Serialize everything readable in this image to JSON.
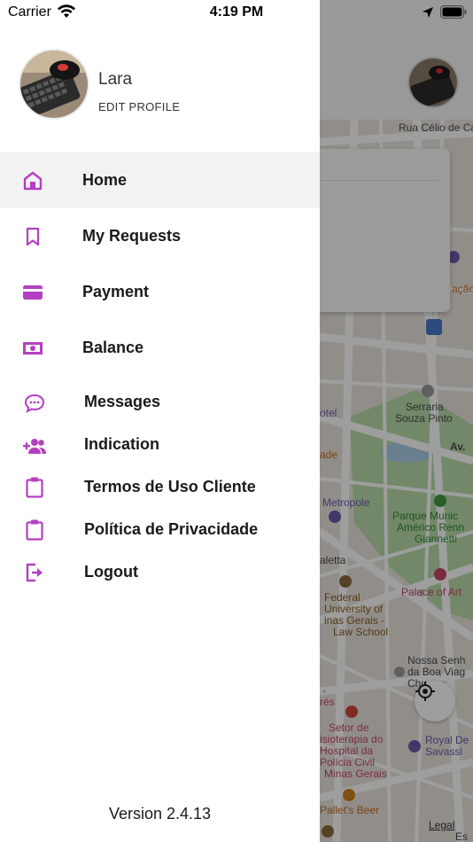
{
  "status_bar": {
    "carrier": "Carrier",
    "time": "4:19 PM"
  },
  "profile": {
    "name": "Lara",
    "edit_label": "EDIT PROFILE"
  },
  "menu": {
    "accent_color": "#b43fc2",
    "items": [
      {
        "label": "Home",
        "icon": "home-icon",
        "active": true
      },
      {
        "label": "My Requests",
        "icon": "bookmark-icon",
        "active": false
      },
      {
        "label": "Payment",
        "icon": "credit-card-icon",
        "active": false
      },
      {
        "label": "Balance",
        "icon": "cash-icon",
        "active": false
      },
      {
        "label": "Messages",
        "icon": "chat-bubble-icon",
        "active": false
      },
      {
        "label": "Indication",
        "icon": "add-users-icon",
        "active": false
      },
      {
        "label": "Termos de Uso Cliente",
        "icon": "clipboard-icon",
        "active": false
      },
      {
        "label": "Política de Privacidade",
        "icon": "clipboard-icon",
        "active": false
      },
      {
        "label": "Logout",
        "icon": "logout-icon",
        "active": false
      }
    ]
  },
  "version": "Version 2.4.13",
  "map": {
    "labels": {
      "rua_celio": "Rua Célio de Ca",
      "acao": "ação",
      "serraria_1": "Serraria",
      "serraria_2": "Souza Pinto",
      "hotel": "otel",
      "av": "Av.",
      "ade": "ade",
      "metropole": "Metropole",
      "parque_1": "Parque Munic",
      "parque_2": "Américo Renn",
      "parque_3": "Giannetti",
      "aletta": "aletta",
      "palace": "Palace of Art",
      "ufmg_1": "Federal",
      "ufmg_2": "University of",
      "ufmg_3": "inas Gerais -",
      "ufmg_4": "Law School",
      "nossa_1": "Nossa Senh",
      "nossa_2": "da Boa Viag",
      "nossa_3": "Chu",
      "res_1": "-",
      "res_2": "rés",
      "setor_1": "Setor de",
      "setor_2": "isioterapia do",
      "setor_3": "Hospital da",
      "setor_4": "Polícia Civil",
      "setor_5": "Minas Gerais",
      "royal_1": "Royal De",
      "royal_2": "Savassi",
      "pallet": "Pallet's Beer",
      "legal": "Legal",
      "es": "Es"
    }
  }
}
